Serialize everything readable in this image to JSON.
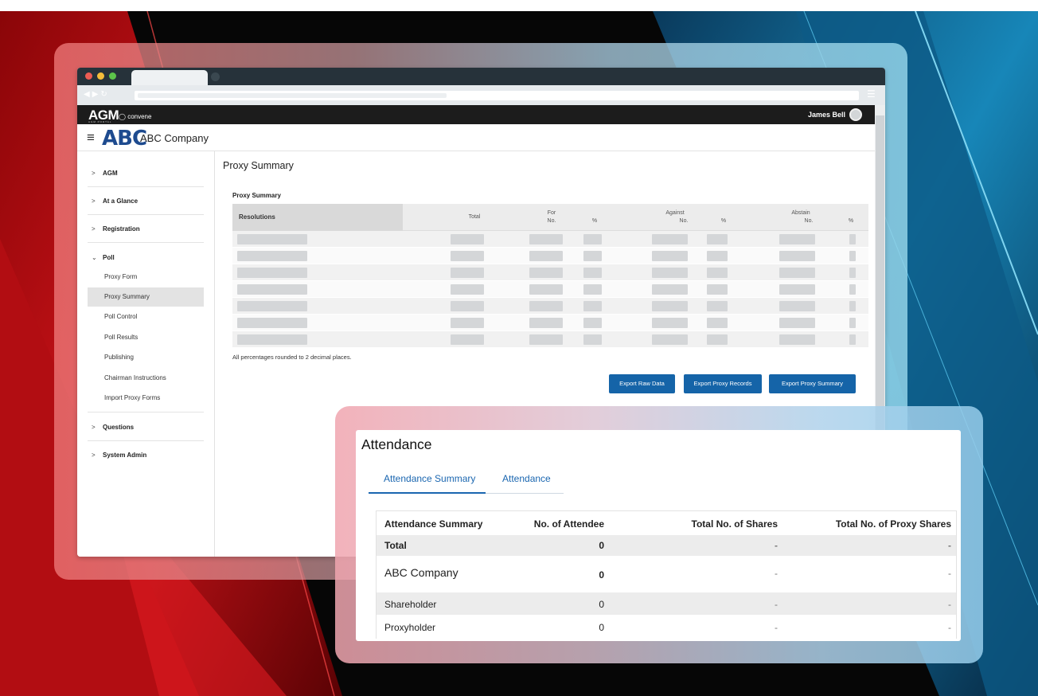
{
  "app": {
    "brand": "AGM",
    "brand_sub": "convene",
    "brand_tagline": "AGM PORTAL",
    "company_logo": "ABC",
    "company_name": "ABC Company",
    "user_name": "James Bell"
  },
  "sidebar": {
    "groups": [
      {
        "label": "AGM",
        "expanded": false
      },
      {
        "label": "At a Glance",
        "expanded": false
      },
      {
        "label": "Registration",
        "expanded": false
      },
      {
        "label": "Poll",
        "expanded": true
      },
      {
        "label": "Questions",
        "expanded": false
      },
      {
        "label": "System Admin",
        "expanded": false
      }
    ],
    "poll_items": [
      "Proxy Form",
      "Proxy Summary",
      "Poll Control",
      "Poll Results",
      "Publishing",
      "Chairman Instructions",
      "Import Proxy Forms"
    ],
    "active_item": "Proxy Summary"
  },
  "proxy_summary": {
    "page_title": "Proxy Summary",
    "table_title": "Proxy Summary",
    "columns": {
      "resolutions": "Resolutions",
      "total": "Total",
      "for": "For",
      "against": "Against",
      "abstain": "Abstain",
      "no": "No.",
      "pct": "%"
    },
    "footnote": "All percentages rounded to 2 decimal places.",
    "buttons": [
      "Export Raw Data",
      "Export Proxy Records",
      "Export Proxy Summary"
    ]
  },
  "attendance": {
    "title": "Attendance",
    "tabs": [
      "Attendance Summary",
      "Attendance"
    ],
    "active_tab": "Attendance Summary",
    "columns": [
      "Attendance Summary",
      "No. of Attendee",
      "Total No. of Shares",
      "Total No. of Proxy Shares"
    ],
    "rows": [
      {
        "label": "Total",
        "attendee": "0",
        "shares": "-",
        "proxy_shares": "-"
      },
      {
        "label": "ABC Company",
        "attendee": "0",
        "shares": "-",
        "proxy_shares": "-"
      },
      {
        "label": "Shareholder",
        "attendee": "0",
        "shares": "-",
        "proxy_shares": "-"
      },
      {
        "label": "Proxyholder",
        "attendee": "0",
        "shares": "-",
        "proxy_shares": "-"
      }
    ]
  },
  "icons": {
    "menu": "hamburger-icon",
    "back": "back-arrow-icon",
    "forward": "forward-arrow-icon",
    "reload": "reload-icon",
    "chevron": "chevron-right-icon",
    "avatar": "user-avatar-icon"
  },
  "colors": {
    "primary_button": "#1564a8",
    "header_bg": "#1c1c1c",
    "tab_active": "#1a66b0",
    "company_logo": "#1e4b8f"
  }
}
